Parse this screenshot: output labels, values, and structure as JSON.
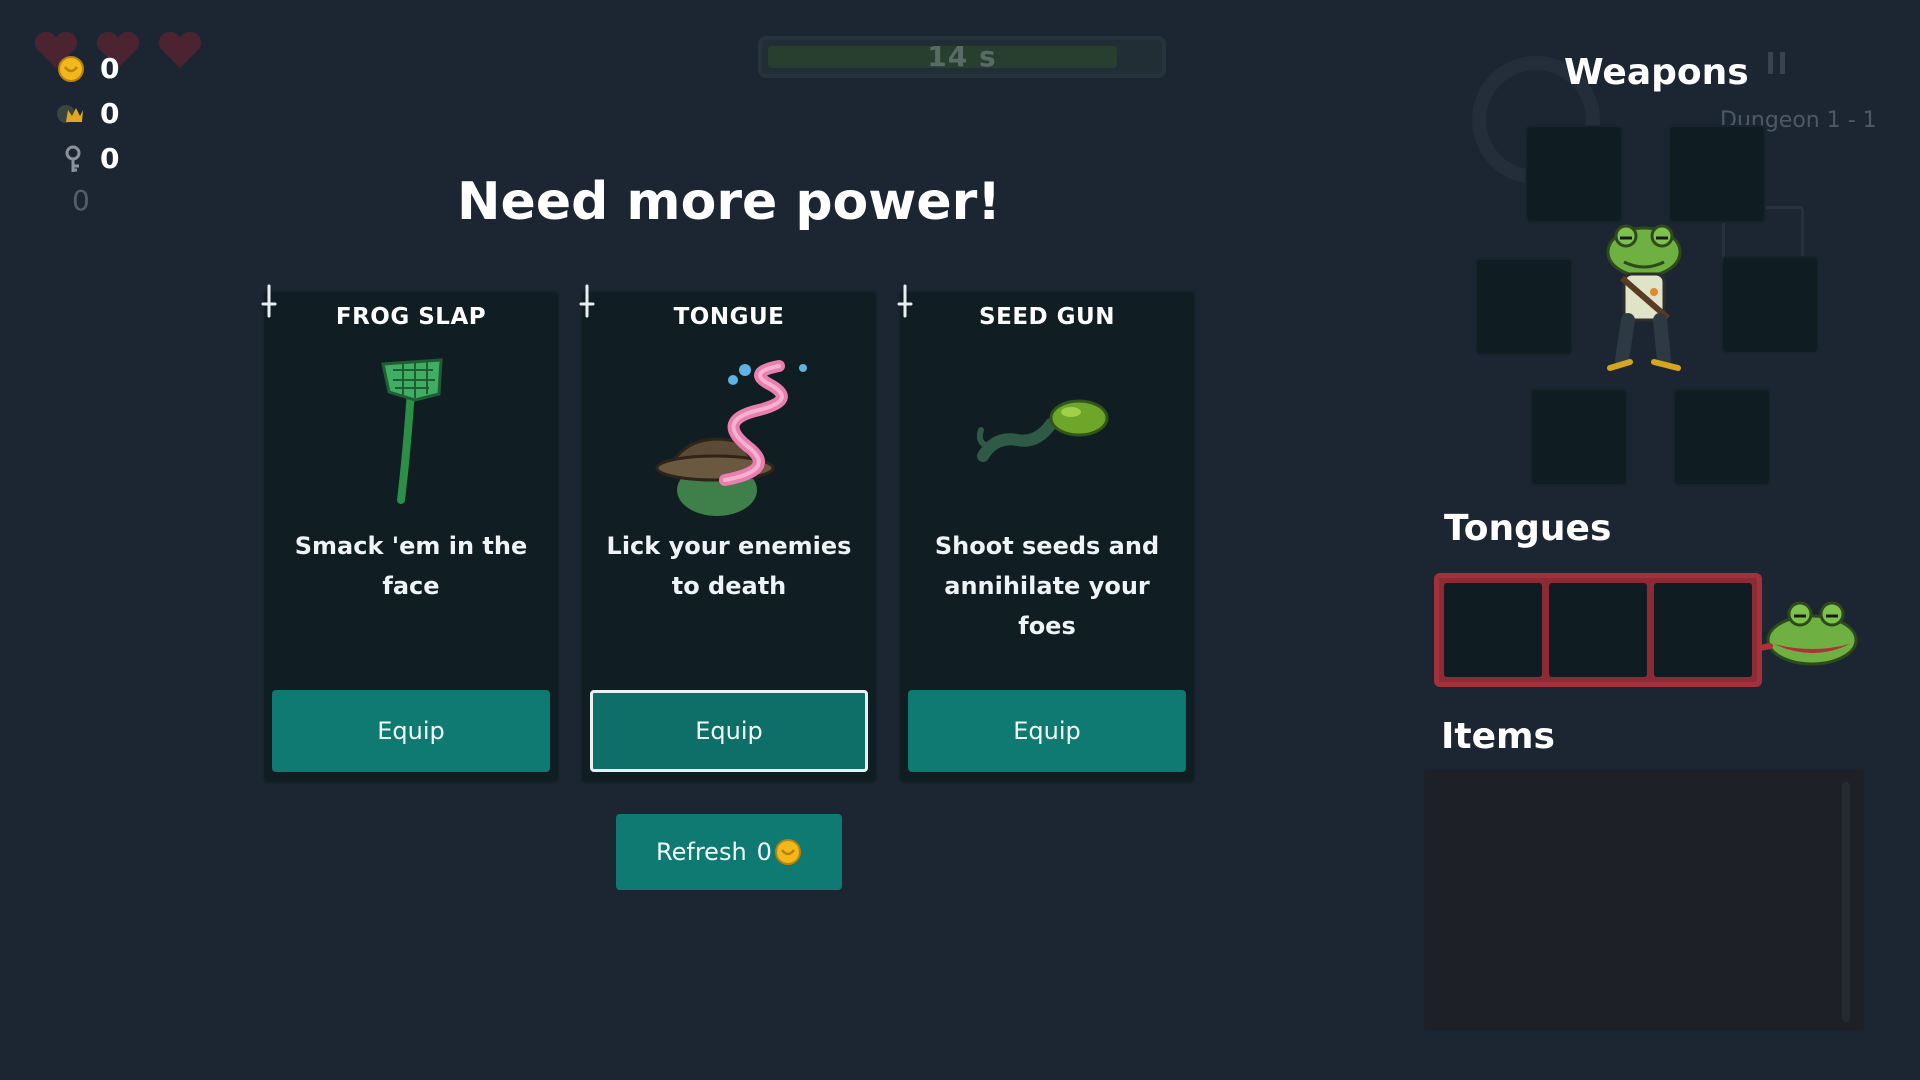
{
  "hud": {
    "hearts": [
      "heart-icon",
      "heart-icon",
      "heart-icon"
    ],
    "coins": "0",
    "crowns": "0",
    "keys": "0",
    "extra": "0",
    "timer": "14 s",
    "timer_progress": 0.9,
    "dungeon": "Dungeon 1 - 1"
  },
  "shop": {
    "title": "Need more power!",
    "cards": [
      {
        "name": "FROG SLAP",
        "icon": "fly-swatter-icon",
        "description": "Smack 'em in the face",
        "button": "Equip"
      },
      {
        "name": "TONGUE",
        "icon": "tongue-icon",
        "description": "Lick your enemies to death",
        "button": "Equip"
      },
      {
        "name": "SEED GUN",
        "icon": "seed-gun-icon",
        "description": "Shoot seeds and annihilate your foes",
        "button": "Equip"
      }
    ],
    "refresh_label": "Refresh",
    "refresh_cost": "0"
  },
  "panel": {
    "weapons_title": "Weapons",
    "tongues_title": "Tongues",
    "items_title": "Items"
  },
  "colors": {
    "background": "#1c2633",
    "card": "#101d23",
    "button": "#0f7a72",
    "tongue_frame": "#a0313d",
    "coin": "#f2b71b"
  }
}
